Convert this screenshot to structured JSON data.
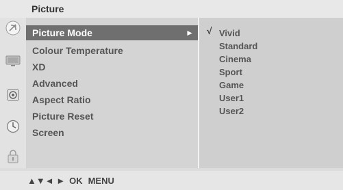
{
  "header": {
    "title": "Picture"
  },
  "rail": {
    "icons": [
      {
        "name": "satellite-dish-icon",
        "selected": true
      },
      {
        "name": "tv-screen-icon",
        "selected": false
      },
      {
        "name": "speaker-icon",
        "selected": false
      },
      {
        "name": "clock-icon",
        "selected": false
      },
      {
        "name": "lock-icon",
        "selected": false
      }
    ]
  },
  "menu": {
    "items": [
      {
        "label": "Picture Mode",
        "selected": true
      },
      {
        "label": "Colour Temperature",
        "selected": false
      },
      {
        "label": "XD",
        "selected": false
      },
      {
        "label": "Advanced",
        "selected": false
      },
      {
        "label": "Aspect Ratio",
        "selected": false
      },
      {
        "label": "Picture Reset",
        "selected": false
      },
      {
        "label": "Screen",
        "selected": false
      }
    ],
    "selected_arrow": "►"
  },
  "options": {
    "check_mark": "√",
    "items": [
      "Vivid",
      "Standard",
      "Cinema",
      "Sport",
      "Game",
      "User1",
      "User2"
    ],
    "checked": "Vivid"
  },
  "footer": {
    "arrows": "▲▼◄ ►",
    "ok_label": "OK",
    "menu_label": "MENU"
  },
  "colors": {
    "selected_bg": "#6f6f6f",
    "menu_bg": "#d4d4d4",
    "options_bg": "#cfcfcf",
    "text": "#555555"
  }
}
